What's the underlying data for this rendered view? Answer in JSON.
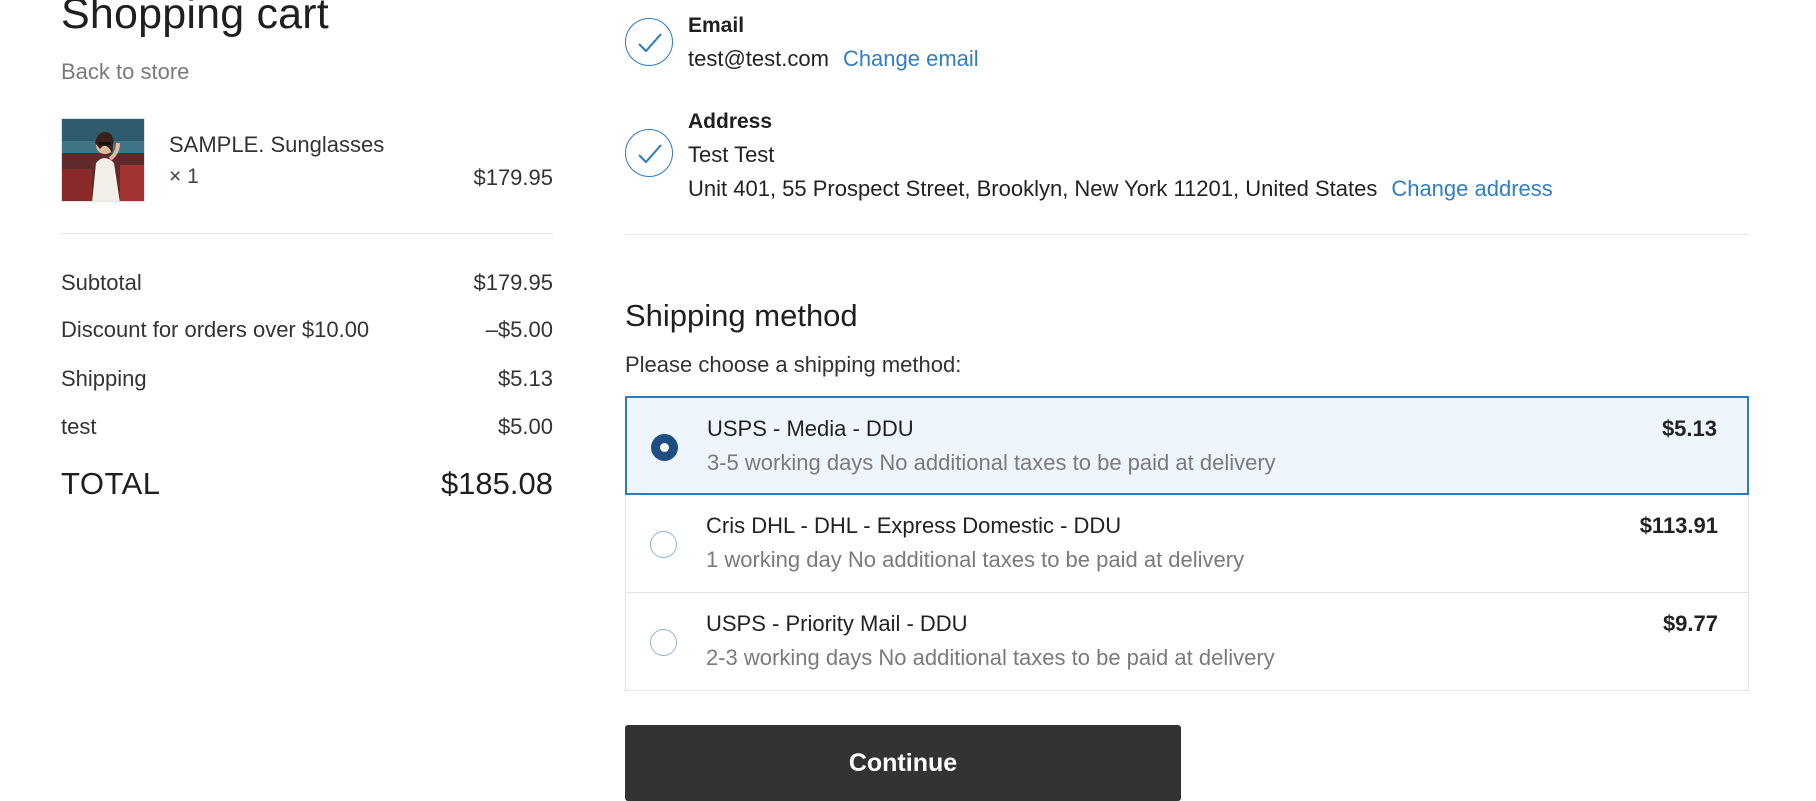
{
  "cart": {
    "title": "Shopping cart",
    "back_link": "Back to store",
    "item": {
      "name": "SAMPLE. Sunglasses",
      "quantity": "× 1",
      "price": "$179.95"
    },
    "totals": [
      {
        "label": "Subtotal",
        "value": "$179.95"
      },
      {
        "label": "Discount for orders over $10.00",
        "value": "–$5.00"
      },
      {
        "label": "Shipping",
        "value": "$5.13"
      },
      {
        "label": "test",
        "value": "$5.00"
      }
    ],
    "grand_total": {
      "label": "TOTAL",
      "value": "$185.08"
    }
  },
  "email_step": {
    "label": "Email",
    "value": "test@test.com",
    "change_link": "Change email",
    "icon": "check-icon"
  },
  "address_step": {
    "label": "Address",
    "name": "Test Test",
    "address": "Unit 401, 55 Prospect Street, Brooklyn, New York 11201, United States",
    "change_link": "Change address",
    "icon": "check-icon"
  },
  "shipping": {
    "title": "Shipping method",
    "prompt": "Please choose a shipping method:",
    "options": [
      {
        "name": "USPS - Media - DDU",
        "description": "3-5 working days No additional taxes to be paid at delivery",
        "price": "$5.13",
        "selected": true
      },
      {
        "name": "Cris DHL - DHL - Express Domestic - DDU",
        "description": "1 working day No additional taxes to be paid at delivery",
        "price": "$113.91",
        "selected": false
      },
      {
        "name": "USPS - Priority Mail - DDU",
        "description": "2-3 working days No additional taxes to be paid at delivery",
        "price": "$9.77",
        "selected": false
      }
    ]
  },
  "continue_label": "Continue",
  "colors": {
    "accent": "#2a7bbf",
    "link": "#2f7ec6",
    "selected_bg": "#eef5fc",
    "radio_on": "#1f4f80",
    "button_bg": "#333333"
  }
}
